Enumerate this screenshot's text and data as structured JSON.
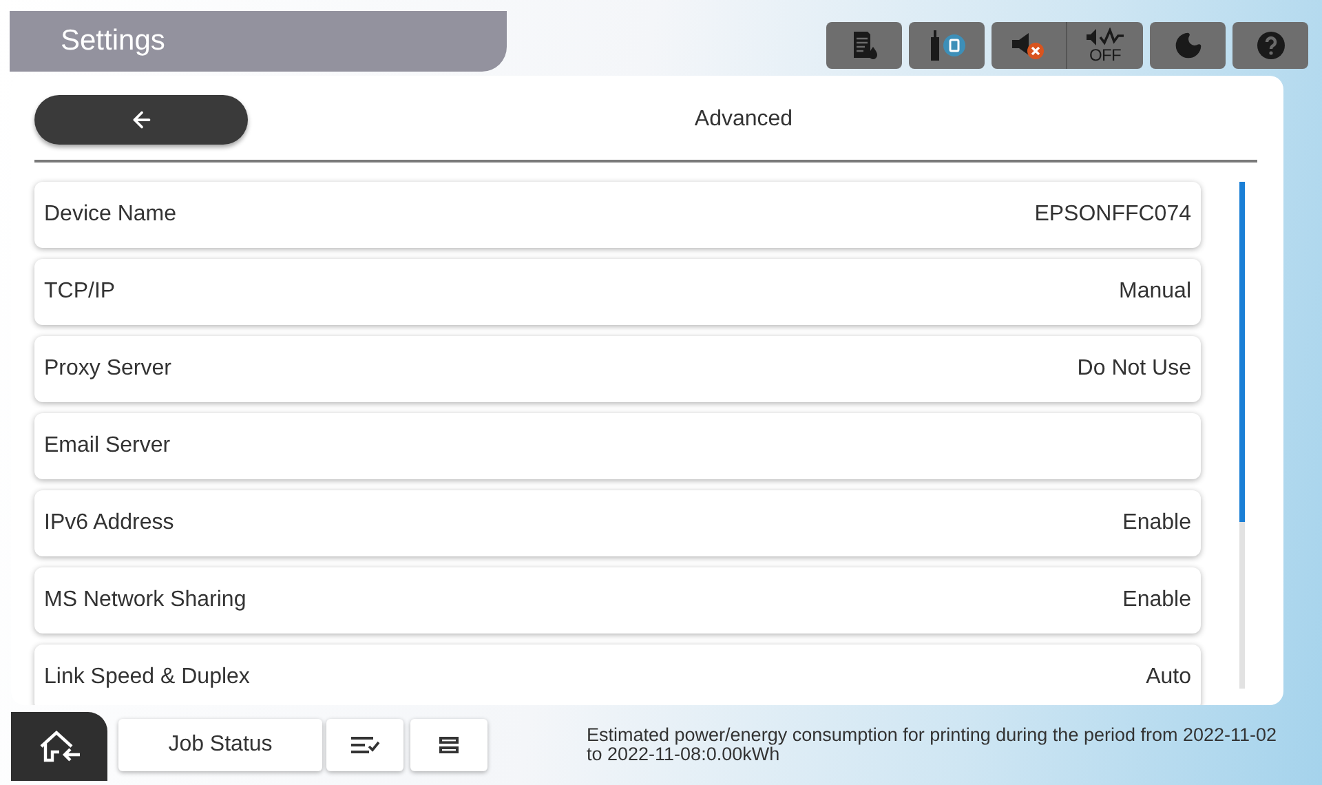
{
  "header": {
    "title": "Settings"
  },
  "status_icons": [
    {
      "kind": "ink"
    },
    {
      "kind": "network"
    },
    {
      "kind": "sound-muted"
    },
    {
      "kind": "quiet",
      "label": "OFF"
    },
    {
      "kind": "sleep"
    },
    {
      "kind": "help"
    }
  ],
  "screen": {
    "title": "Advanced"
  },
  "rows": [
    {
      "label": "Device Name",
      "value": "EPSONFFC074"
    },
    {
      "label": "TCP/IP",
      "value": "Manual"
    },
    {
      "label": "Proxy Server",
      "value": "Do Not Use"
    },
    {
      "label": "Email Server"
    },
    {
      "label": "IPv6 Address",
      "value": "Enable"
    },
    {
      "label": "MS Network Sharing",
      "value": "Enable"
    },
    {
      "label": "Link Speed & Duplex",
      "value": "Auto"
    }
  ],
  "bottom_bar": {
    "job_status": "Job Status",
    "notice": "Estimated power/energy consumption for printing during the period from 2022-11-02 to 2022-11-08:0.00kWh"
  }
}
